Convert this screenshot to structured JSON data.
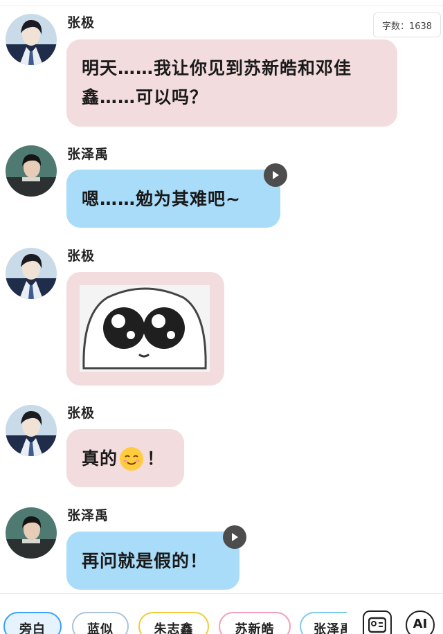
{
  "counter": {
    "text": "字数：1638"
  },
  "messages": [
    {
      "speaker": "张极",
      "text": "明天……我让你见到苏新皓和邓佳鑫……可以吗？",
      "line1": "明天……我让你见到苏新皓和邓佳",
      "line2": "鑫……可以吗？",
      "style": "pink"
    },
    {
      "speaker": "张泽禹",
      "text": "嗯……勉为其难吧~",
      "style": "blue",
      "has_voice": true
    },
    {
      "speaker": "张极",
      "text": "",
      "style": "pink",
      "sticker": "crying-eyes-sticker"
    },
    {
      "speaker": "张极",
      "text_before": "真的",
      "emoji": "blush-emoji",
      "text_after": "！",
      "style": "pink"
    },
    {
      "speaker": "张泽禹",
      "text": "再问就是假的！",
      "style": "blue",
      "has_voice": true
    }
  ],
  "toolbar": {
    "chips": [
      {
        "label": "旁白",
        "color": "#3aa0ff",
        "selected": true
      },
      {
        "label": "蓝似",
        "color": "#a9c3d9"
      },
      {
        "label": "朱志鑫",
        "color": "#f3cc3a"
      },
      {
        "label": "苏新皓",
        "color": "#f2a0b6"
      },
      {
        "label": "张泽禹",
        "color": "#7fcaf0"
      }
    ],
    "ai_label": "AI",
    "icons": [
      "character-card-icon",
      "ai-icon"
    ]
  },
  "colors": {
    "pink_bubble": "#f3dcdd",
    "blue_bubble": "#a9dcf8",
    "voice_button": "#4d4d4d"
  }
}
